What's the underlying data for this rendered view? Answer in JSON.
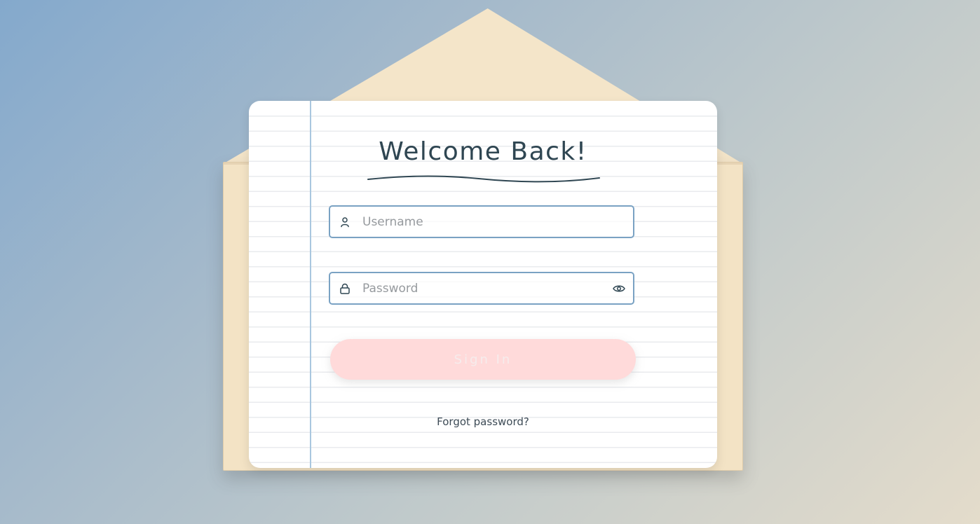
{
  "page": {
    "title": "Welcome Back!"
  },
  "form": {
    "username": {
      "placeholder": "Username",
      "value": "",
      "icon": "user-icon"
    },
    "password": {
      "placeholder": "Password",
      "value": "",
      "icon": "lock-icon",
      "toggle_icon": "eye-icon"
    },
    "submit_label": "Sign In",
    "forgot_label": "Forgot password?"
  },
  "colors": {
    "title_text": "#2f4652",
    "input_border": "#7aa2c3",
    "button_bg": "#ffdada",
    "envelope": "#f4e5c9",
    "margin_line": "#a9c7df"
  }
}
